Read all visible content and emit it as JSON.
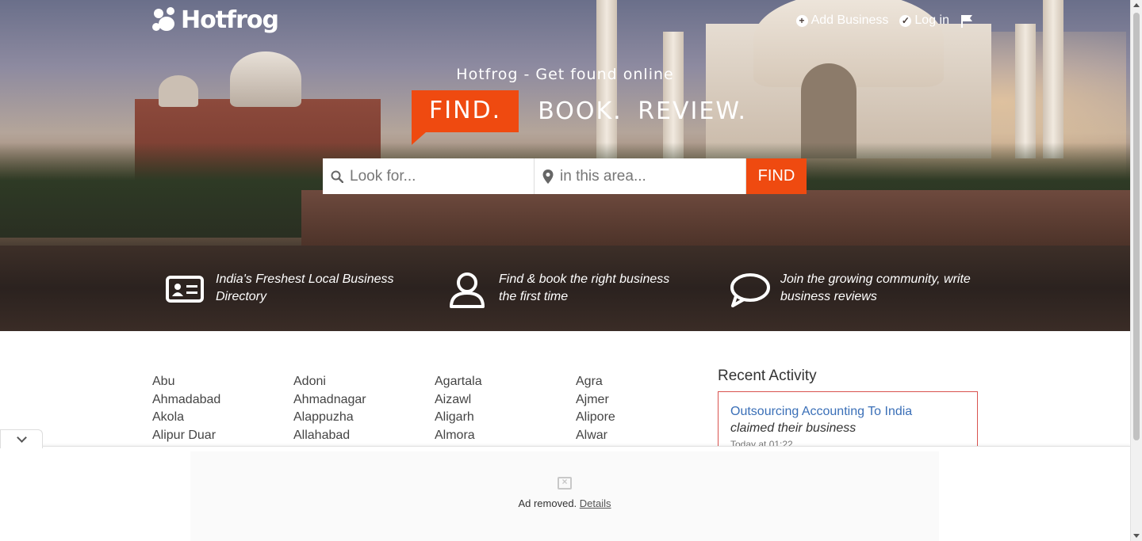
{
  "brand": {
    "name": "Hotfrog"
  },
  "nav": {
    "add_business": "Add Business",
    "login": "Log in"
  },
  "hero": {
    "tagline": "Hotfrog - Get found online",
    "find": "FIND.",
    "book_review": "BOOK. REVIEW."
  },
  "search": {
    "what_placeholder": "Look for...",
    "where_placeholder": "in this area...",
    "button": "FIND"
  },
  "features": [
    {
      "icon": "id-card-icon",
      "text": "India's Freshest Local Business Directory"
    },
    {
      "icon": "user-icon",
      "text": "Find & book the right business the first time"
    },
    {
      "icon": "speech-bubble-icon",
      "text": "Join the growing community, write business reviews"
    }
  ],
  "cities": [
    [
      "Abu",
      "Ahmadabad",
      "Akola",
      "Alipur Duar"
    ],
    [
      "Adoni",
      "Ahmadnagar",
      "Alappuzha",
      "Allahabad"
    ],
    [
      "Agartala",
      "Aizawl",
      "Aligarh",
      "Almora"
    ],
    [
      "Agra",
      "Ajmer",
      "Alipore",
      "Alwar"
    ]
  ],
  "recent": {
    "title": "Recent Activity",
    "business": "Outsourcing Accounting To India",
    "action": "claimed their business",
    "time": "Today at 01:22"
  },
  "ad": {
    "text": "Ad removed.",
    "details": "Details"
  }
}
